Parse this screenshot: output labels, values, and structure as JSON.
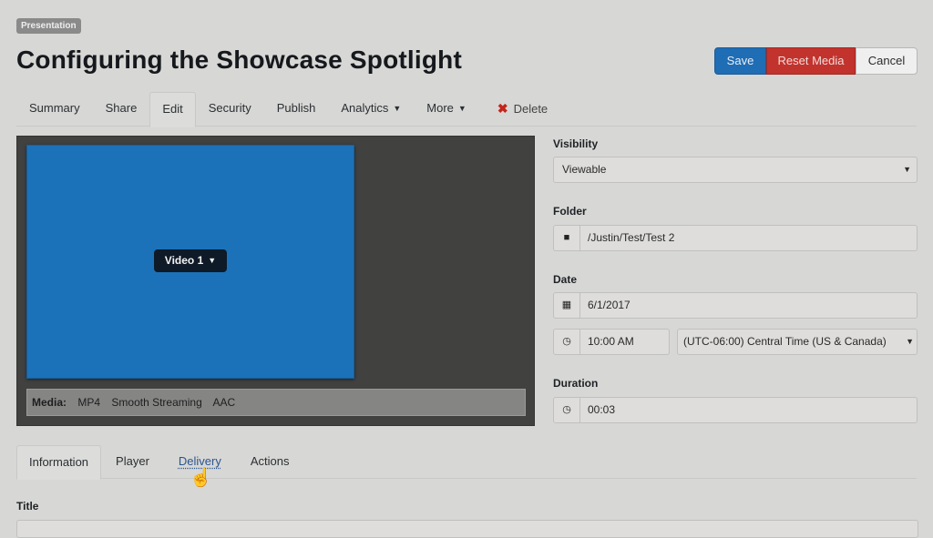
{
  "header": {
    "badge": "Presentation",
    "title": "Configuring the Showcase Spotlight"
  },
  "actions": {
    "save": "Save",
    "reset_media": "Reset Media",
    "cancel": "Cancel"
  },
  "colors": {
    "save": "#1f6db4",
    "reset_media": "#c2332d",
    "video_area": "#1c72b9",
    "delete_icon": "#c4241b"
  },
  "nav_tabs": [
    {
      "label": "Summary"
    },
    {
      "label": "Share"
    },
    {
      "label": "Edit",
      "active": true
    },
    {
      "label": "Security"
    },
    {
      "label": "Publish"
    },
    {
      "label": "Analytics",
      "dropdown": true
    },
    {
      "label": "More",
      "dropdown": true
    },
    {
      "label": "Delete",
      "icon": "close-x-icon"
    }
  ],
  "player": {
    "video_select": "Video 1",
    "media_label": "Media:",
    "formats": [
      "MP4",
      "Smooth Streaming",
      "AAC"
    ]
  },
  "form": {
    "visibility": {
      "label": "Visibility",
      "value": "Viewable"
    },
    "folder": {
      "label": "Folder",
      "value": "/Justin/Test/Test 2",
      "icon": "folder-icon"
    },
    "date": {
      "label": "Date",
      "value": "6/1/2017",
      "icon": "calendar-icon"
    },
    "time": {
      "value": "10:00 AM",
      "icon": "clock-icon"
    },
    "timezone": {
      "value": "(UTC-06:00) Central Time (US & Canada)"
    },
    "duration": {
      "label": "Duration",
      "value": "00:03",
      "icon": "clock-icon"
    }
  },
  "sub_tabs": [
    {
      "label": "Information",
      "active": true
    },
    {
      "label": "Player"
    },
    {
      "label": "Delivery",
      "hover": true
    },
    {
      "label": "Actions"
    }
  ],
  "details": {
    "title_label": "Title"
  }
}
